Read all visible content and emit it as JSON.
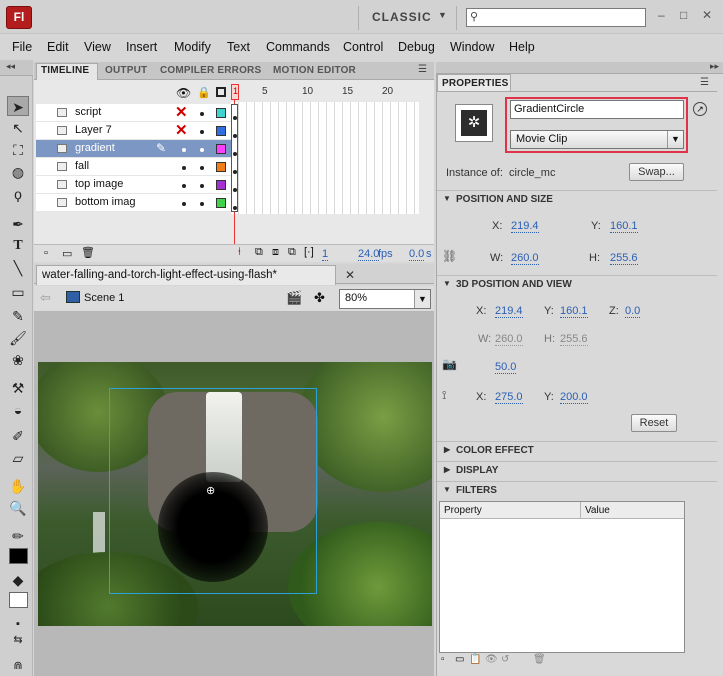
{
  "app": {
    "logo": "Fl",
    "workspace": "CLASSIC"
  },
  "menu": [
    "File",
    "Edit",
    "View",
    "Insert",
    "Modify",
    "Text",
    "Commands",
    "Control",
    "Debug",
    "Window",
    "Help"
  ],
  "timeline": {
    "tabs": [
      "TIMELINE",
      "OUTPUT",
      "COMPILER ERRORS",
      "MOTION EDITOR"
    ],
    "frame_numbers": [
      "1",
      "5",
      "10",
      "15",
      "20"
    ],
    "layers": [
      {
        "name": "script",
        "color": "#3fd3d3"
      },
      {
        "name": "Layer 7",
        "color": "#2f6fe0"
      },
      {
        "name": "gradient",
        "color": "#ff3fff"
      },
      {
        "name": "fall",
        "color": "#f07f1a"
      },
      {
        "name": "top image",
        "color": "#a52fd0"
      },
      {
        "name": "bottom imag",
        "color": "#3fd34a"
      }
    ],
    "current_frame": "1",
    "fps": "24.0",
    "fps_unit": "fps",
    "time": "0.0",
    "time_unit": "s"
  },
  "document": {
    "tab_title": "water-falling-and-torch-light-effect-using-flash*",
    "scene": "Scene 1",
    "zoom": "80%"
  },
  "properties": {
    "header": "PROPERTIES",
    "instance_name": "GradientCircle",
    "symbol_type": "Movie Clip",
    "instance_of_label": "Instance of:",
    "instance_of": "circle_mc",
    "swap_label": "Swap...",
    "pos_size": {
      "title": "POSITION AND SIZE",
      "x": "219.4",
      "y": "160.1",
      "w": "260.0",
      "h": "255.6"
    },
    "pos3d": {
      "title": "3D POSITION AND VIEW",
      "x": "219.4",
      "y": "160.1",
      "z": "0.0",
      "w": "260.0",
      "h": "255.6",
      "perspective": "50.0",
      "vx": "275.0",
      "vy": "200.0"
    },
    "reset_label": "Reset",
    "sections": [
      "COLOR EFFECT",
      "DISPLAY",
      "FILTERS"
    ],
    "filters_cols": [
      "Property",
      "Value"
    ],
    "labels": {
      "x": "X:",
      "y": "Y:",
      "z": "Z:",
      "w": "W:",
      "h": "H:"
    }
  }
}
